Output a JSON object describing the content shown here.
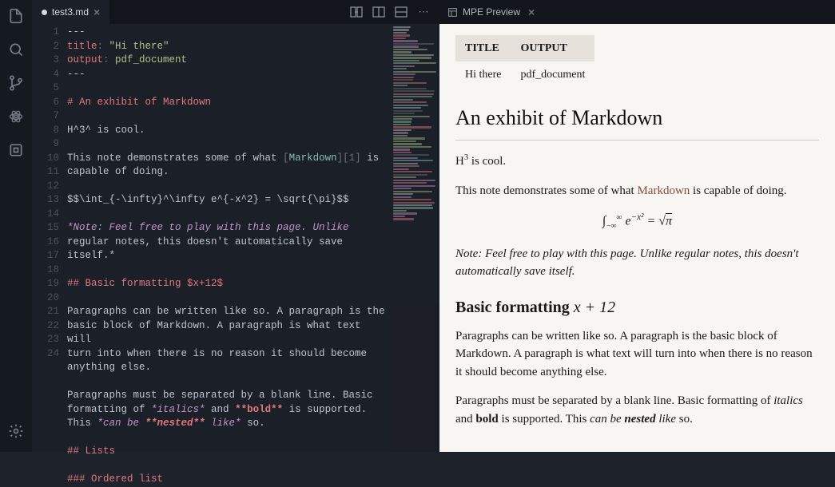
{
  "activity": {
    "icons": [
      "file-icon",
      "search-icon",
      "git-branch-icon",
      "atom-icon",
      "package-icon",
      "gear-icon"
    ]
  },
  "editor": {
    "tab": {
      "unsaved": true,
      "filename": "test3.md"
    },
    "actions": [
      "diff-icon",
      "split-horizontal-icon",
      "split-vertical-icon",
      "more-icon"
    ],
    "lines": [
      {
        "n": 1,
        "text": "---"
      },
      {
        "n": 2,
        "html": "<span class='yml-key'>title</span><span class='delim'>:</span> <span class='yml-str'>\"Hi there\"</span>"
      },
      {
        "n": 3,
        "html": "<span class='yml-key'>output</span><span class='delim'>:</span> <span class='yml-str'>pdf_document</span>"
      },
      {
        "n": 4,
        "text": "---"
      },
      {
        "n": 5,
        "text": ""
      },
      {
        "n": 6,
        "html": "<span class='md-h1'># An exhibit of Markdown</span>"
      },
      {
        "n": 7,
        "text": ""
      },
      {
        "n": 8,
        "text": "H^3^ is cool."
      },
      {
        "n": 9,
        "text": ""
      },
      {
        "n": 10,
        "html": "This note demonstrates some of what <span class='delim'>[</span><span class='md-link'>Markdown</span><span class='delim'>][1]</span> is\ncapable of doing."
      },
      {
        "n": 11,
        "text": ""
      },
      {
        "n": 12,
        "text": "$$\\int_{-\\infty}^\\infty e^{-x^2} = \\sqrt{\\pi}$$"
      },
      {
        "n": 13,
        "text": ""
      },
      {
        "n": 14,
        "html": "<span class='md-italic'>*Note: Feel free to play with this page. Unlike\nregular notes, this doesn't automatically save itself.*</span>"
      },
      {
        "n": 15,
        "text": ""
      },
      {
        "n": 16,
        "html": "<span class='md-h2'>## Basic formatting $x+12$</span>"
      },
      {
        "n": 17,
        "text": ""
      },
      {
        "n": 18,
        "text": "Paragraphs can be written like so. A paragraph is the\nbasic block of Markdown. A paragraph is what text will\nturn into when there is no reason it should become\nanything else."
      },
      {
        "n": 19,
        "text": ""
      },
      {
        "n": 20,
        "html": "Paragraphs must be separated by a blank line. Basic\nformatting of <span class='md-italic'>*italics*</span> and <span class='md-bold'>**bold**</span> is supported.\nThis <span class='md-italic'>*can be <span class='md-bold'>**nested**</span> like*</span> so."
      },
      {
        "n": 21,
        "text": ""
      },
      {
        "n": 22,
        "html": "<span class='md-h2'>## Lists</span>"
      },
      {
        "n": 23,
        "text": ""
      },
      {
        "n": 24,
        "html": "<span class='md-h2'>### Ordered list</span>"
      }
    ]
  },
  "preview": {
    "tab_label": "MPE Preview",
    "table": {
      "headers": [
        "TITLE",
        "OUTPUT"
      ],
      "row": [
        "Hi there",
        "pdf_document"
      ]
    },
    "h1": "An exhibit of Markdown",
    "p1_prefix": "H",
    "p1_sup": "3",
    "p1_suffix": " is cool.",
    "p2_a": "This note demonstrates some of what ",
    "p2_link": "Markdown",
    "p2_b": " is capable of doing.",
    "math": "∫<sub style='font-size:0.6em'>−∞</sub><sup style='font-size:0.6em'>∞</sup>&nbsp;e<sup style='font-size:0.7em'>−x²</sup>&nbsp;=&nbsp;√<span style='text-decoration:overline'>π</span>",
    "note": "Note: Feel free to play with this page. Unlike regular notes, this doesn't automatically save itself.",
    "h2_a": "Basic formatting ",
    "h2_math": "x + 12",
    "p3": "Paragraphs can be written like so. A paragraph is the basic block of Markdown. A paragraph is what text will turn into when there is no reason it should become anything else.",
    "p4_a": "Paragraphs must be separated by a blank line. Basic formatting of ",
    "p4_i": "italics",
    "p4_b": " and ",
    "p4_bold": "bold",
    "p4_c": " is supported. This ",
    "p4_i2a": "can be ",
    "p4_i2b": "nested",
    "p4_i2c": " like",
    "p4_d": " so."
  }
}
